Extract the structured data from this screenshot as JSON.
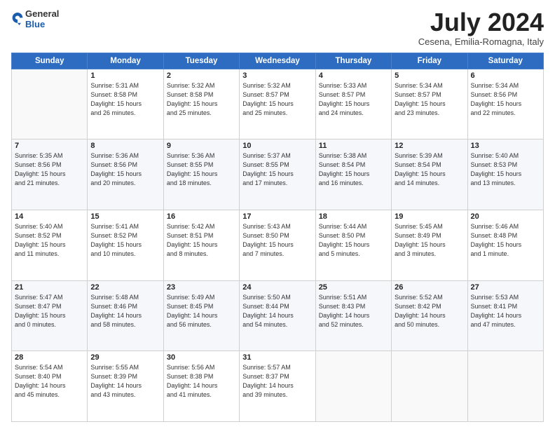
{
  "header": {
    "logo": {
      "general": "General",
      "blue": "Blue"
    },
    "title": "July 2024",
    "subtitle": "Cesena, Emilia-Romagna, Italy"
  },
  "days_of_week": [
    "Sunday",
    "Monday",
    "Tuesday",
    "Wednesday",
    "Thursday",
    "Friday",
    "Saturday"
  ],
  "weeks": [
    [
      {
        "day": "",
        "info": ""
      },
      {
        "day": "1",
        "info": "Sunrise: 5:31 AM\nSunset: 8:58 PM\nDaylight: 15 hours\nand 26 minutes."
      },
      {
        "day": "2",
        "info": "Sunrise: 5:32 AM\nSunset: 8:58 PM\nDaylight: 15 hours\nand 25 minutes."
      },
      {
        "day": "3",
        "info": "Sunrise: 5:32 AM\nSunset: 8:57 PM\nDaylight: 15 hours\nand 25 minutes."
      },
      {
        "day": "4",
        "info": "Sunrise: 5:33 AM\nSunset: 8:57 PM\nDaylight: 15 hours\nand 24 minutes."
      },
      {
        "day": "5",
        "info": "Sunrise: 5:34 AM\nSunset: 8:57 PM\nDaylight: 15 hours\nand 23 minutes."
      },
      {
        "day": "6",
        "info": "Sunrise: 5:34 AM\nSunset: 8:56 PM\nDaylight: 15 hours\nand 22 minutes."
      }
    ],
    [
      {
        "day": "7",
        "info": "Sunrise: 5:35 AM\nSunset: 8:56 PM\nDaylight: 15 hours\nand 21 minutes."
      },
      {
        "day": "8",
        "info": "Sunrise: 5:36 AM\nSunset: 8:56 PM\nDaylight: 15 hours\nand 20 minutes."
      },
      {
        "day": "9",
        "info": "Sunrise: 5:36 AM\nSunset: 8:55 PM\nDaylight: 15 hours\nand 18 minutes."
      },
      {
        "day": "10",
        "info": "Sunrise: 5:37 AM\nSunset: 8:55 PM\nDaylight: 15 hours\nand 17 minutes."
      },
      {
        "day": "11",
        "info": "Sunrise: 5:38 AM\nSunset: 8:54 PM\nDaylight: 15 hours\nand 16 minutes."
      },
      {
        "day": "12",
        "info": "Sunrise: 5:39 AM\nSunset: 8:54 PM\nDaylight: 15 hours\nand 14 minutes."
      },
      {
        "day": "13",
        "info": "Sunrise: 5:40 AM\nSunset: 8:53 PM\nDaylight: 15 hours\nand 13 minutes."
      }
    ],
    [
      {
        "day": "14",
        "info": "Sunrise: 5:40 AM\nSunset: 8:52 PM\nDaylight: 15 hours\nand 11 minutes."
      },
      {
        "day": "15",
        "info": "Sunrise: 5:41 AM\nSunset: 8:52 PM\nDaylight: 15 hours\nand 10 minutes."
      },
      {
        "day": "16",
        "info": "Sunrise: 5:42 AM\nSunset: 8:51 PM\nDaylight: 15 hours\nand 8 minutes."
      },
      {
        "day": "17",
        "info": "Sunrise: 5:43 AM\nSunset: 8:50 PM\nDaylight: 15 hours\nand 7 minutes."
      },
      {
        "day": "18",
        "info": "Sunrise: 5:44 AM\nSunset: 8:50 PM\nDaylight: 15 hours\nand 5 minutes."
      },
      {
        "day": "19",
        "info": "Sunrise: 5:45 AM\nSunset: 8:49 PM\nDaylight: 15 hours\nand 3 minutes."
      },
      {
        "day": "20",
        "info": "Sunrise: 5:46 AM\nSunset: 8:48 PM\nDaylight: 15 hours\nand 1 minute."
      }
    ],
    [
      {
        "day": "21",
        "info": "Sunrise: 5:47 AM\nSunset: 8:47 PM\nDaylight: 15 hours\nand 0 minutes."
      },
      {
        "day": "22",
        "info": "Sunrise: 5:48 AM\nSunset: 8:46 PM\nDaylight: 14 hours\nand 58 minutes."
      },
      {
        "day": "23",
        "info": "Sunrise: 5:49 AM\nSunset: 8:45 PM\nDaylight: 14 hours\nand 56 minutes."
      },
      {
        "day": "24",
        "info": "Sunrise: 5:50 AM\nSunset: 8:44 PM\nDaylight: 14 hours\nand 54 minutes."
      },
      {
        "day": "25",
        "info": "Sunrise: 5:51 AM\nSunset: 8:43 PM\nDaylight: 14 hours\nand 52 minutes."
      },
      {
        "day": "26",
        "info": "Sunrise: 5:52 AM\nSunset: 8:42 PM\nDaylight: 14 hours\nand 50 minutes."
      },
      {
        "day": "27",
        "info": "Sunrise: 5:53 AM\nSunset: 8:41 PM\nDaylight: 14 hours\nand 47 minutes."
      }
    ],
    [
      {
        "day": "28",
        "info": "Sunrise: 5:54 AM\nSunset: 8:40 PM\nDaylight: 14 hours\nand 45 minutes."
      },
      {
        "day": "29",
        "info": "Sunrise: 5:55 AM\nSunset: 8:39 PM\nDaylight: 14 hours\nand 43 minutes."
      },
      {
        "day": "30",
        "info": "Sunrise: 5:56 AM\nSunset: 8:38 PM\nDaylight: 14 hours\nand 41 minutes."
      },
      {
        "day": "31",
        "info": "Sunrise: 5:57 AM\nSunset: 8:37 PM\nDaylight: 14 hours\nand 39 minutes."
      },
      {
        "day": "",
        "info": ""
      },
      {
        "day": "",
        "info": ""
      },
      {
        "day": "",
        "info": ""
      }
    ]
  ]
}
